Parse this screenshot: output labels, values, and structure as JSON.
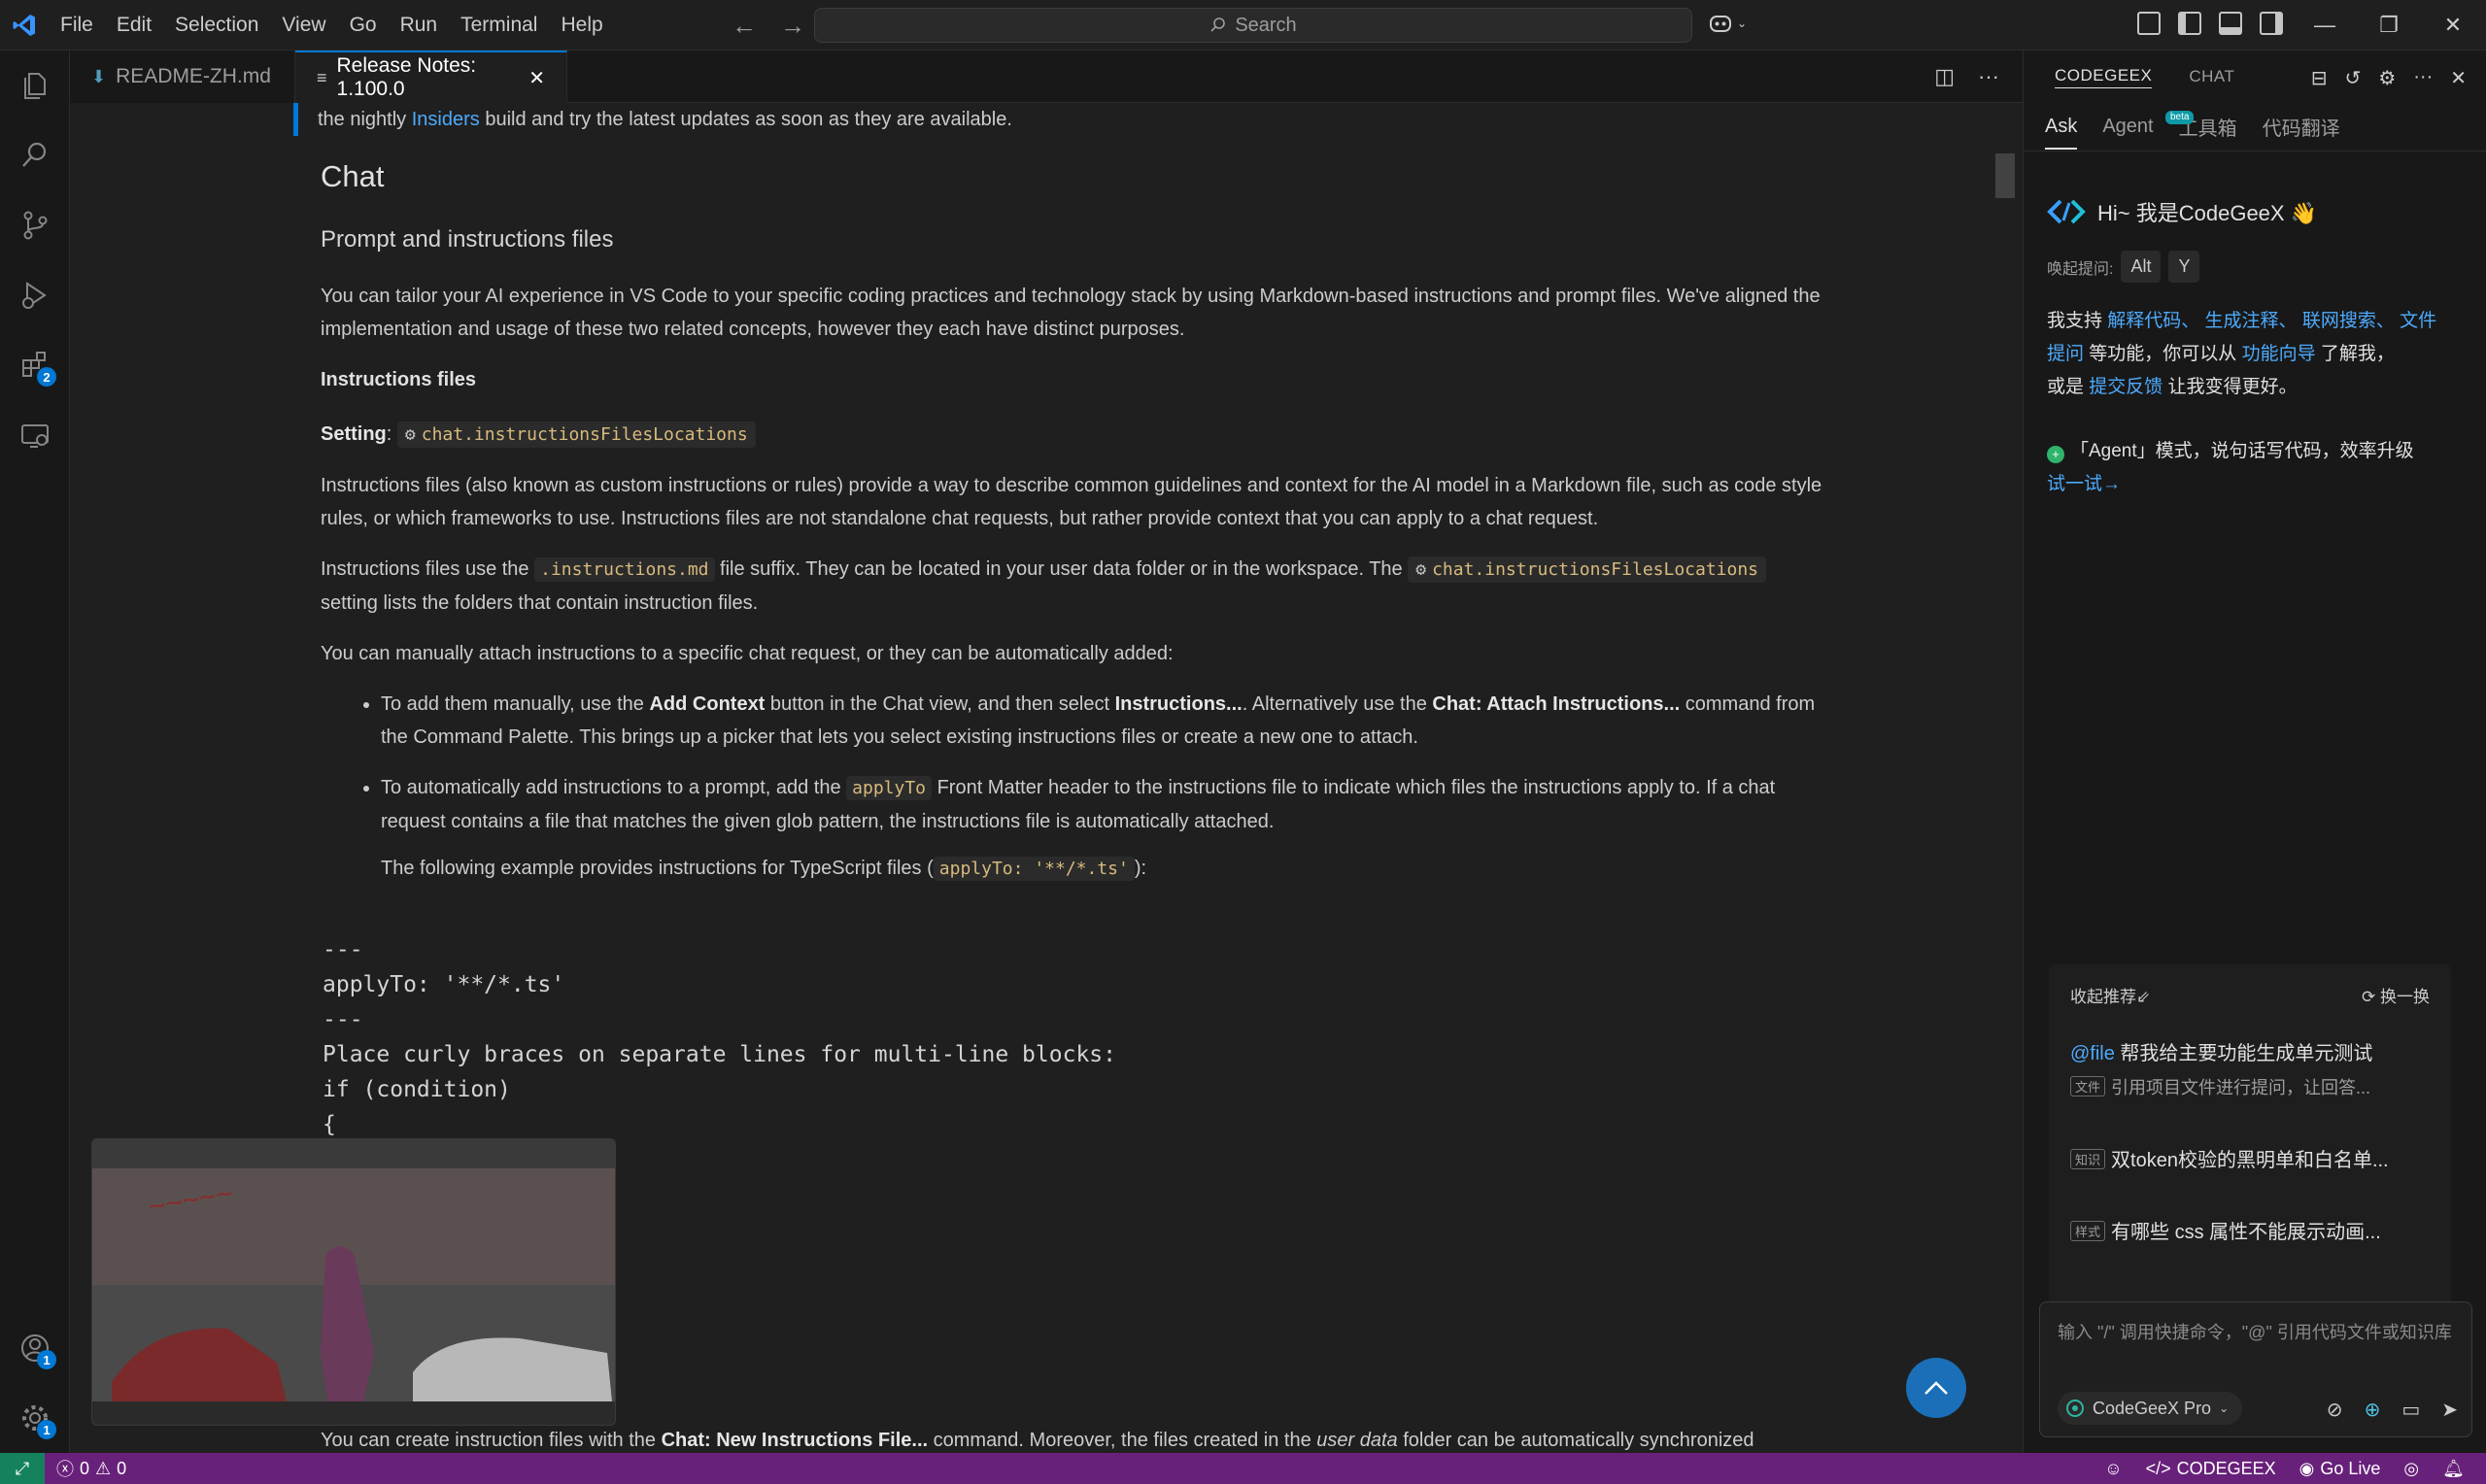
{
  "titlebar": {
    "menu": [
      "File",
      "Edit",
      "Selection",
      "View",
      "Go",
      "Run",
      "Terminal",
      "Help"
    ],
    "search_placeholder": "Search"
  },
  "activity_bar": {
    "extensions_badge": "2",
    "accounts_badge": "1",
    "settings_badge": "1"
  },
  "tabs": [
    {
      "label": "README-ZH.md",
      "icon": "markdown-icon"
    },
    {
      "label": "Release Notes: 1.100.0",
      "icon": "preview-icon"
    }
  ],
  "doc": {
    "note_pre": "the nightly ",
    "note_link": "Insiders",
    "note_post": " build and try the latest updates as soon as they are available.",
    "h_chat": "Chat",
    "h_prompt": "Prompt and instructions files",
    "p_intro": "You can tailor your AI experience in VS Code to your specific coding practices and technology stack by using Markdown-based instructions and prompt files. We've aligned the implementation and usage of these two related concepts, however they each have distinct purposes.",
    "h_instr": "Instructions files",
    "setting_label": "Setting",
    "setting_sep": ":",
    "setting_value": "chat.instructionsFilesLocations",
    "p_instr": "Instructions files (also known as custom instructions or rules) provide a way to describe common guidelines and context for the AI model in a Markdown file, such as code style rules, or which frameworks to use. Instructions files are not standalone chat requests, but rather provide context that you can apply to a chat request.",
    "p_suffix_1": "Instructions files use the ",
    "p_suffix_code": ".instructions.md",
    "p_suffix_2": " file suffix. They can be located in your user data folder or in the workspace. The ",
    "p_suffix_setting": "chat.instructionsFilesLocations",
    "p_suffix_3": "setting lists the folders that contain instruction files.",
    "p_manual": "You can manually attach instructions to a specific chat request, or they can be automatically added:",
    "li1_a": "To add them manually, use the ",
    "li1_b": "Add Context",
    "li1_c": " button in the Chat view, and then select ",
    "li1_d": "Instructions...",
    "li1_e": ". Alternatively use the ",
    "li1_f": "Chat: Attach Instructions...",
    "li1_g": " command from the Command Palette. This brings up a picker that lets you select existing instructions files or create a new one to attach.",
    "li2_a": "To automatically add instructions to a prompt, add the ",
    "li2_code": "applyTo",
    "li2_b": " Front Matter header to the instructions file to indicate which files the instructions apply to. If a chat request contains a file that matches the given glob pattern, the instructions file is automatically attached.",
    "example_a": "The following example provides instructions for TypeScript files (",
    "example_code": "applyTo: '**/*.ts'",
    "example_b": "):",
    "code": "---\napplyTo: '**/*.ts'\n---\nPlace curly braces on separate lines for multi-line blocks:\nif (condition)\n{\n  doSomething();\n}\nelse\n{\n  doSomethingElse();\n}",
    "bottom_a": "You can create instruction files with the ",
    "bottom_b": "Chat: New Instructions File...",
    "bottom_c": " command. Moreover, the files created in the ",
    "bottom_d": "user data",
    "bottom_e": " folder can be automatically synchronized"
  },
  "panel": {
    "tabs": [
      "CODEGEEX",
      "CHAT"
    ],
    "sub_tabs": [
      "Ask",
      "Agent",
      "工具箱",
      "代码翻译"
    ],
    "beta_label": "beta",
    "greeting": "Hi~ 我是CodeGeeX 👋",
    "hotkey_label": "唤起提问:",
    "hotkey_keys": [
      "Alt",
      "Y"
    ],
    "support_1": "我支持 ",
    "support_links": "解释代码、 生成注释、 联网搜索、 文件提问",
    "support_2": " 等功能，你可以从 ",
    "support_link2": "功能向导",
    "support_3": " 了解我，",
    "support_4": "或是 ",
    "support_link3": "提交反馈",
    "support_5": " 让我变得更好。",
    "agent_text": "「Agent」模式，说句话写代码，效率升级",
    "agent_link": "试一试→",
    "rec_title": "收起推荐⇙",
    "rec_refresh": "换一换",
    "rec_items": [
      {
        "prefix": "@file",
        "text": " 帮我给主要功能生成单元测试",
        "tag": "文件",
        "sub": "引用项目文件进行提问，让回答..."
      },
      {
        "tag": "知识",
        "text": "双token校验的黑明单和白名单..."
      },
      {
        "tag": "样式",
        "text": "有哪些 css 属性不能展示动画..."
      }
    ],
    "input_placeholder": "输入 \"/\" 调用快捷命令，\"@\" 引用代码文件或知识库",
    "model": "CodeGeeX Pro"
  },
  "statusbar": {
    "errors": "0",
    "warnings": "0",
    "codegeex": "CODEGEEX",
    "golive": "Go Live"
  }
}
